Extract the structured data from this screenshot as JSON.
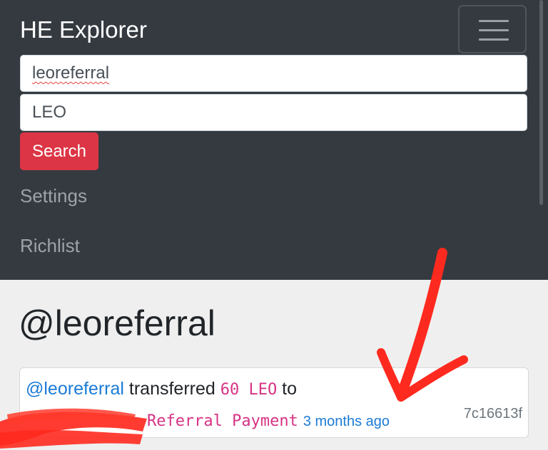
{
  "navbar": {
    "brand": "HE Explorer",
    "account_input": {
      "value": "leoreferral"
    },
    "token_input": {
      "value": "LEO"
    },
    "search_label": "Search",
    "links": [
      "Settings",
      "Richlist"
    ]
  },
  "main": {
    "heading": "@leoreferral",
    "transaction": {
      "from": "@leoreferral",
      "action": "transferred",
      "amount": "60 LEO",
      "to_word": "to",
      "memo": "Referral Payment",
      "time": "3 months ago",
      "hash": "7c16613f"
    }
  },
  "colors": {
    "navbar_bg": "#343a40",
    "search_button": "#dc3545",
    "link": "#1b7bd6",
    "code": "#d63384",
    "annotation": "#ff2a1f"
  },
  "icons": [
    "hamburger-menu-icon"
  ]
}
